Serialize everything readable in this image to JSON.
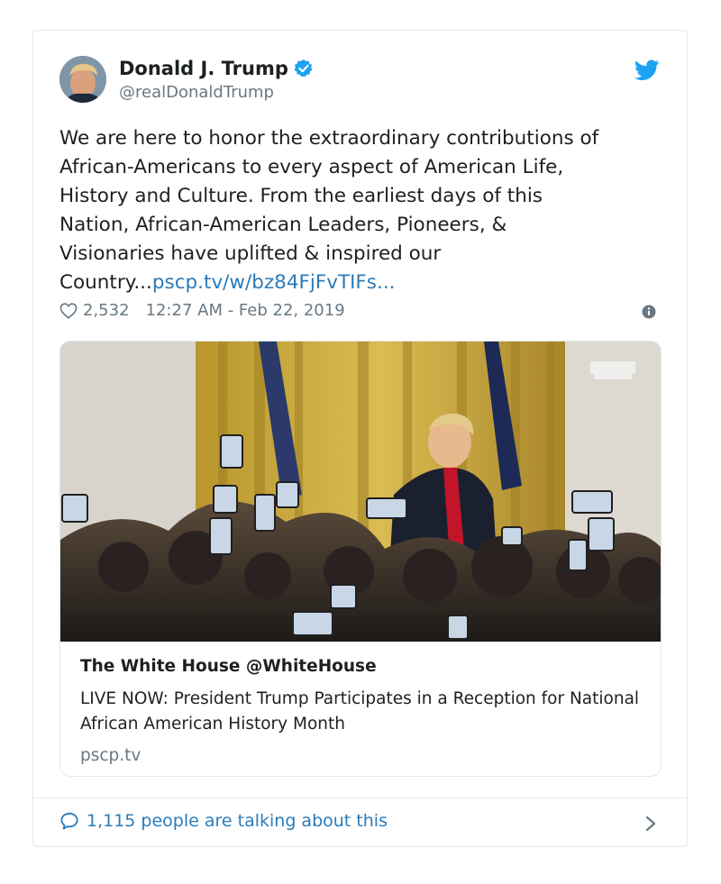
{
  "tweet": {
    "author_name": "Donald J. Trump",
    "handle": "@realDonaldTrump",
    "text": "We are here to honor the extraordinary contributions of\nAfrican-Americans to every aspect of American Life,\nHistory and Culture. From the earliest days of this\nNation, African-American Leaders, Pioneers, &\nVisionaries have uplifted & inspired our\nCountry...",
    "link_text": "pscp.tv/w/bz84FjFvTIFs...",
    "likes": "2,532",
    "timestamp": "12:27 AM - Feb 22, 2019"
  },
  "media_card": {
    "title": "The White House @WhiteHouse",
    "description": "LIVE NOW: President Trump Participates in a Reception for National African American History Month",
    "domain": "pscp.tv"
  },
  "footer": {
    "talking": "1,115 people are talking about this"
  },
  "icons": {
    "verified": "verified-badge-icon",
    "brand": "twitter-bird-icon",
    "like": "heart-icon",
    "info": "info-icon",
    "reply": "speech-bubble-icon",
    "chevron": "chevron-right-icon"
  },
  "colors": {
    "accent": "#1da1f2",
    "link": "#2b7bb9",
    "muted": "#697882",
    "text": "#1c2022",
    "border": "#e1e8ed"
  }
}
